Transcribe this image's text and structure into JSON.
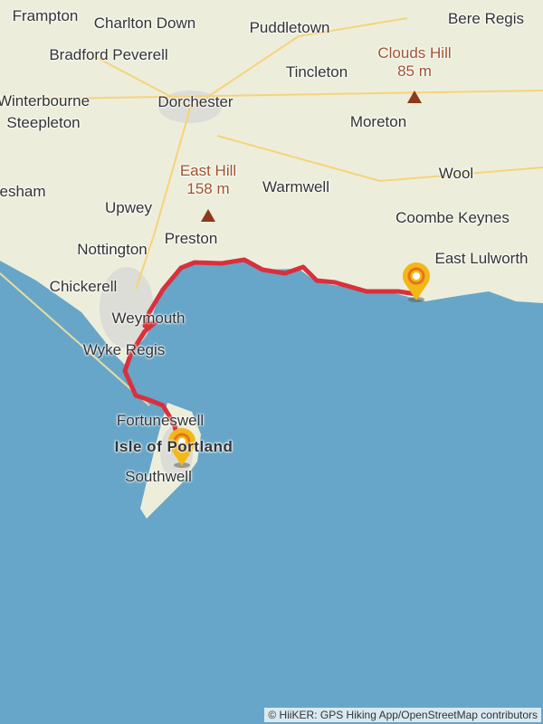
{
  "map": {
    "colors": {
      "sea": "#67a6c8",
      "land": "#eceedb",
      "route": "#d9303e",
      "marker": "#f2b817",
      "marker_ring": "#e8721c"
    },
    "places": [
      {
        "name": "Frampton"
      },
      {
        "name": "Charlton Down"
      },
      {
        "name": "Puddletown"
      },
      {
        "name": "Bere Regis"
      },
      {
        "name": "Bradford Peverell"
      },
      {
        "name": "Tincleton"
      },
      {
        "name": "Winterbourne"
      },
      {
        "name": "Steepleton"
      },
      {
        "name": "Dorchester"
      },
      {
        "name": "Moreton"
      },
      {
        "name": "Wool"
      },
      {
        "name": "esham"
      },
      {
        "name": "Upwey"
      },
      {
        "name": "Warmwell"
      },
      {
        "name": "Coombe Keynes"
      },
      {
        "name": "Nottington"
      },
      {
        "name": "Preston"
      },
      {
        "name": "East Lulworth"
      },
      {
        "name": "Chickerell"
      },
      {
        "name": "Weymouth"
      },
      {
        "name": "Wyke Regis"
      },
      {
        "name": "Fortuneswell"
      },
      {
        "name": "Southwell"
      }
    ],
    "island": "Isle of Portland",
    "peaks": [
      {
        "name": "Clouds Hill",
        "elevation": "85 m"
      },
      {
        "name": "East Hill",
        "elevation": "158 m"
      }
    ],
    "route": {
      "start": "Isle of Portland",
      "end": "near East Lulworth"
    }
  },
  "attribution": "© HiiKER: GPS Hiking App/OpenStreetMap contributors"
}
